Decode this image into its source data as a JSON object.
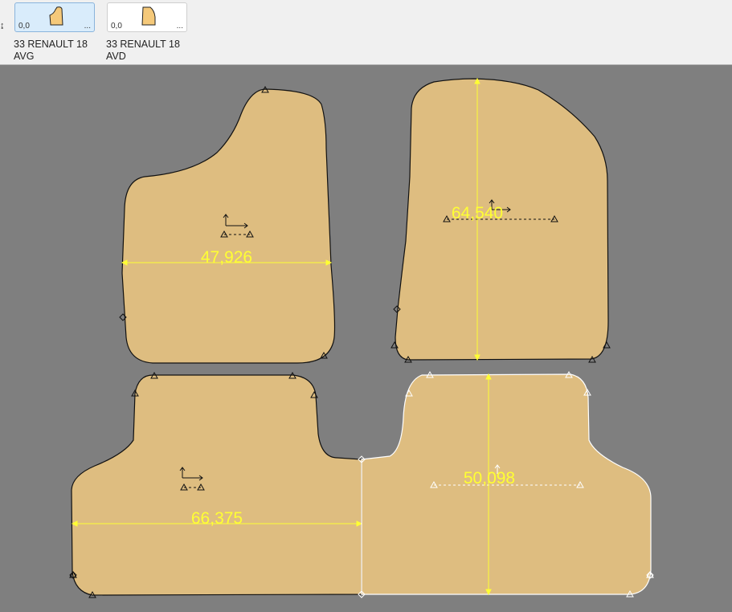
{
  "toolbar": {
    "edge_glyph": "↨",
    "items": [
      {
        "value": "0,0",
        "more": "...",
        "line1": "33 RENAULT 18",
        "line2": "AVG",
        "selected": true
      },
      {
        "value": "0,0",
        "more": "...",
        "line1": "33 RENAULT 18",
        "line2": "AVD",
        "selected": false
      }
    ]
  },
  "canvas": {
    "colors": {
      "background": "#7f7f7f",
      "piece_fill": "#debd80",
      "dimension": "#ffff33",
      "outline": "#111111",
      "selected_outline": "#ffffff"
    },
    "pieces": [
      {
        "name": "front-left-mat",
        "dimension": "47,926",
        "selected": false
      },
      {
        "name": "front-right-mat",
        "dimension": "64,540",
        "selected": false
      },
      {
        "name": "rear-left-mat",
        "dimension": "66,375",
        "selected": false
      },
      {
        "name": "rear-right-mat",
        "dimension": "50,098",
        "selected": true
      }
    ]
  }
}
